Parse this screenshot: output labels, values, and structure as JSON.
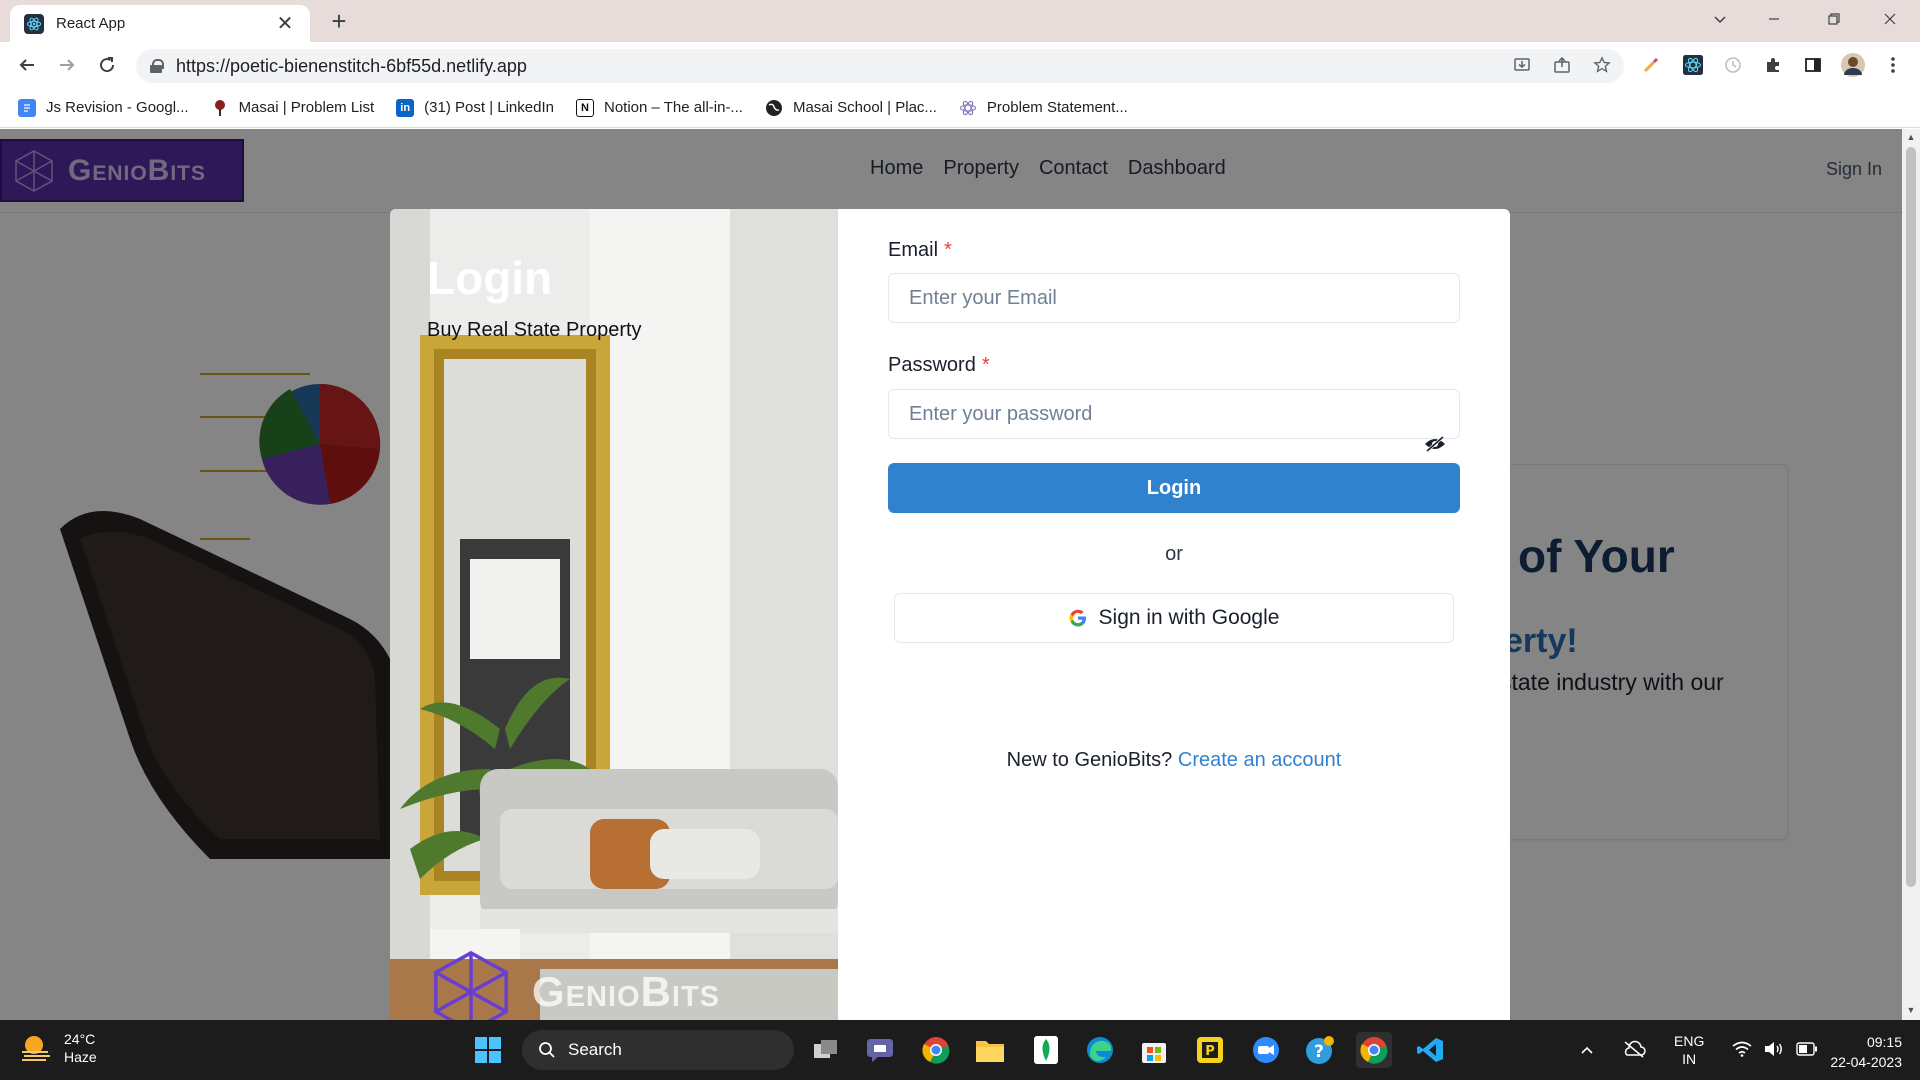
{
  "browser": {
    "tab_title": "React App",
    "tab_close": "✕",
    "new_tab": "+",
    "url": "https://poetic-bienenstitch-6bf55d.netlify.app",
    "bookmarks": [
      {
        "label": "Js Revision - Googl...",
        "icon": "google-docs-icon",
        "color": "#4285f4"
      },
      {
        "label": "Masai | Problem List",
        "icon": "masai-icon",
        "color": "#6b1d1d"
      },
      {
        "label": "(31) Post | LinkedIn",
        "icon": "linkedin-icon",
        "color": "#0a66c2"
      },
      {
        "label": "Notion – The all-in-...",
        "icon": "notion-icon",
        "color": "#111111"
      },
      {
        "label": "Masai School | Plac...",
        "icon": "globe-icon",
        "color": "#222222"
      },
      {
        "label": "Problem Statement...",
        "icon": "react-icon",
        "color": "#8e7cc3"
      }
    ]
  },
  "site": {
    "logo_text": "GenioBits",
    "nav": [
      "Home",
      "Property",
      "Contact",
      "Dashboard"
    ],
    "signin": "Sign In",
    "hero_heading": "of Your",
    "hero_subheading": "erty!",
    "hero_text": "state industry with our"
  },
  "modal": {
    "title": "Login",
    "subtitle": "Buy Real State Property",
    "logo_text": "GenioBits",
    "email_label": "Email",
    "email_placeholder": "Enter your Email",
    "password_label": "Password",
    "password_placeholder": "Enter your password",
    "required_mark": "*",
    "login_button": "Login",
    "or_text": "or",
    "google_button": "Sign in with Google",
    "signup_prompt": "New to GenioBits?",
    "signup_link": "Create an account",
    "colors": {
      "primary": "#3182ce",
      "required": "#e53e3e"
    }
  },
  "taskbar": {
    "temperature": "24°C",
    "weather": "Haze",
    "search": "Search",
    "language": "ENG",
    "region": "IN",
    "time": "09:15",
    "date": "22-04-2023"
  }
}
